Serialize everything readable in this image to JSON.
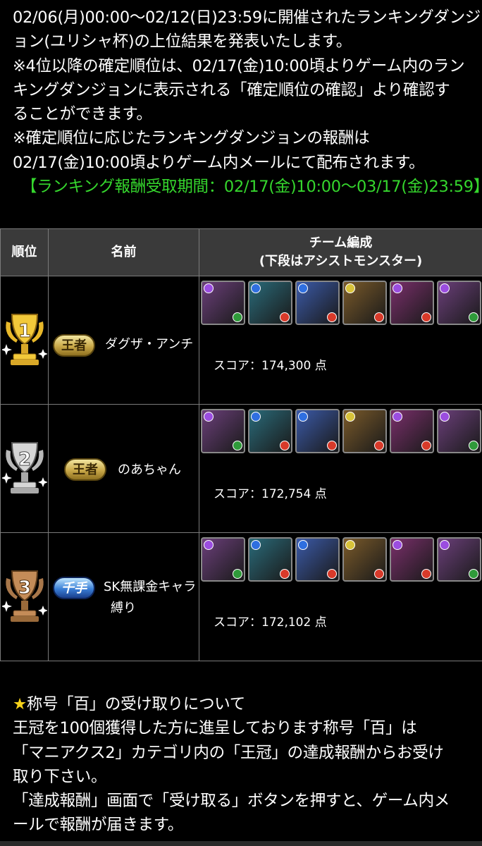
{
  "intro": {
    "lines": [
      "02/06(月)00:00～02/12(日)23:59に開催されたランキングダンジ",
      "ョン(ユリシャ杯)の上位結果を発表いたします。",
      "※4位以降の確定順位は、02/17(金)10:00頃よりゲーム内のラン",
      "キングダンジョンに表示される「確定順位の確認」より確認す",
      "ることができます。",
      "※確定順位に応じたランキングダンジョンの報酬は",
      "02/17(金)10:00頃よりゲーム内メールにて配布されます。"
    ],
    "reward_period": "【ランキング報酬受取期間：02/17(金)10:00～03/17(金)23:59】"
  },
  "table": {
    "headers": {
      "rank": "順位",
      "name": "名前",
      "team_line1": "チーム編成",
      "team_line2": "(下段はアシストモンスター)"
    },
    "rows": [
      {
        "rank": "1",
        "badge": "王者",
        "badge_style": "gold",
        "name_lines": [
          "ダグザ・アンチ"
        ],
        "score": "スコア：174,300 点"
      },
      {
        "rank": "2",
        "badge": "王者",
        "badge_style": "gold",
        "name_lines": [
          "のあちゃん"
        ],
        "score": "スコア：172,754 点"
      },
      {
        "rank": "3",
        "badge": "千手",
        "badge_style": "blue",
        "name_lines": [
          "SK無課金キャラ",
          "縛り"
        ],
        "score": "スコア：172,102 点"
      }
    ]
  },
  "team_icons": [
    {
      "icon": "dark-wood-monster-portrait",
      "bg": "#6b3f7a",
      "orb1": "#9b4de0",
      "orb2": "#2f9a3a"
    },
    {
      "icon": "water-fire-monster-portrait",
      "bg": "#2a6b7a",
      "orb1": "#2f6fe0",
      "orb2": "#d83a2a"
    },
    {
      "icon": "water-fire-monster-portrait",
      "bg": "#3b5aa8",
      "orb1": "#2f6fe0",
      "orb2": "#d83a2a"
    },
    {
      "icon": "light-fire-monster-portrait",
      "bg": "#7a5a2a",
      "orb1": "#d8c23a",
      "orb2": "#d83a2a"
    },
    {
      "icon": "dark-fire-monster-portrait",
      "bg": "#7a2f6b",
      "orb1": "#9b4de0",
      "orb2": "#d83a2a"
    },
    {
      "icon": "dark-wood-monster-portrait",
      "bg": "#6b3f7a",
      "orb1": "#9b4de0",
      "orb2": "#2f9a3a"
    }
  ],
  "trophy_colors": {
    "1": "#e8b82a",
    "2": "#b9b9b9",
    "3": "#a8774a"
  },
  "notice": {
    "star": "★",
    "title": "称号「百」の受け取りについて",
    "lines": [
      "王冠を100個獲得した方に進呈しております称号「百」は",
      "「マニアクス2」カテゴリ内の「王冠」の達成報酬からお受け",
      "取り下さい。",
      "「達成報酬」画面で「受け取る」ボタンを押すと、ゲーム内メ",
      "ールで報酬が届きます。"
    ]
  }
}
